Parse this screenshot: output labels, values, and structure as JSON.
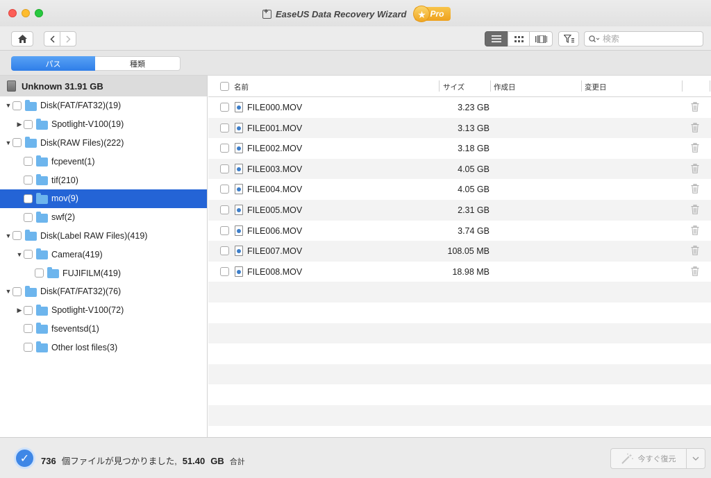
{
  "window": {
    "title": "EaseUS Data Recovery Wizard",
    "badge": "Pro"
  },
  "toolbar": {
    "search_placeholder": "検索"
  },
  "tabs": [
    {
      "label": "パス",
      "active": true
    },
    {
      "label": "種類",
      "active": false
    }
  ],
  "sidebar": {
    "drive_label": "Unknown 31.91 GB",
    "items": [
      {
        "label": "Disk(FAT/FAT32)(19)",
        "level": 0,
        "arrow": "▼"
      },
      {
        "label": "Spotlight-V100(19)",
        "level": 1,
        "arrow": "▶"
      },
      {
        "label": "Disk(RAW Files)(222)",
        "level": 0,
        "arrow": "▼"
      },
      {
        "label": "fcpevent(1)",
        "level": 1,
        "arrow": ""
      },
      {
        "label": "tif(210)",
        "level": 1,
        "arrow": ""
      },
      {
        "label": "mov(9)",
        "level": 1,
        "arrow": "",
        "selected": true
      },
      {
        "label": "swf(2)",
        "level": 1,
        "arrow": ""
      },
      {
        "label": "Disk(Label RAW Files)(419)",
        "level": 0,
        "arrow": "▼"
      },
      {
        "label": "Camera(419)",
        "level": 1,
        "arrow": "▼"
      },
      {
        "label": "FUJIFILM(419)",
        "level": 2,
        "arrow": ""
      },
      {
        "label": "Disk(FAT/FAT32)(76)",
        "level": 0,
        "arrow": "▼"
      },
      {
        "label": "Spotlight-V100(72)",
        "level": 1,
        "arrow": "▶"
      },
      {
        "label": "fseventsd(1)",
        "level": 1,
        "arrow": ""
      },
      {
        "label": "Other lost files(3)",
        "level": 1,
        "arrow": ""
      }
    ]
  },
  "filelist": {
    "columns": {
      "name": "名前",
      "size": "サイズ",
      "created": "作成日",
      "modified": "変更日"
    },
    "rows": [
      {
        "name": "FILE000.MOV",
        "size": "3.23 GB"
      },
      {
        "name": "FILE001.MOV",
        "size": "3.13 GB"
      },
      {
        "name": "FILE002.MOV",
        "size": "3.18 GB"
      },
      {
        "name": "FILE003.MOV",
        "size": "4.05 GB"
      },
      {
        "name": "FILE004.MOV",
        "size": "4.05 GB"
      },
      {
        "name": "FILE005.MOV",
        "size": "2.31 GB"
      },
      {
        "name": "FILE006.MOV",
        "size": "3.74 GB"
      },
      {
        "name": "FILE007.MOV",
        "size": "108.05 MB"
      },
      {
        "name": "FILE008.MOV",
        "size": "18.98 MB"
      }
    ],
    "empty_rows": 8
  },
  "status": {
    "count": "736",
    "found_text": "個ファイルが見つかりました,",
    "total": "51.40",
    "unit": "GB",
    "total_suffix": "合計"
  },
  "recover_button": {
    "label": "今すぐ復元"
  },
  "colors": {
    "accent": "#2464d6",
    "tab_active": "#3f87e6",
    "pro_badge": "#f2b12e"
  }
}
